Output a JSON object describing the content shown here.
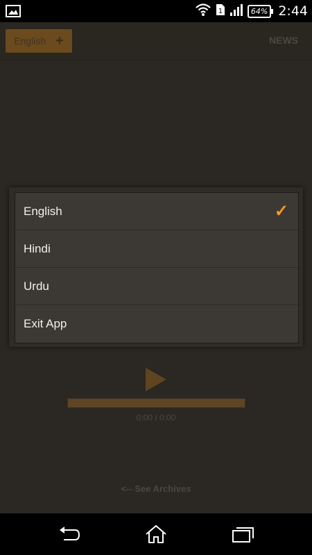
{
  "status_bar": {
    "battery": "64%",
    "time": "2:44"
  },
  "action_bar": {
    "language_label": "English",
    "plus_symbol": "+",
    "news_label": "NEWS"
  },
  "dialog": {
    "options": [
      {
        "label": "English",
        "selected": true
      },
      {
        "label": "Hindi",
        "selected": false
      },
      {
        "label": "Urdu",
        "selected": false
      },
      {
        "label": "Exit App",
        "selected": false
      }
    ],
    "check_symbol": "✓"
  },
  "player": {
    "time": "0:00 / 0:00",
    "archives_label": "<-- See Archives"
  },
  "colors": {
    "accent": "#ff9a1e",
    "background": "#2b2722"
  }
}
